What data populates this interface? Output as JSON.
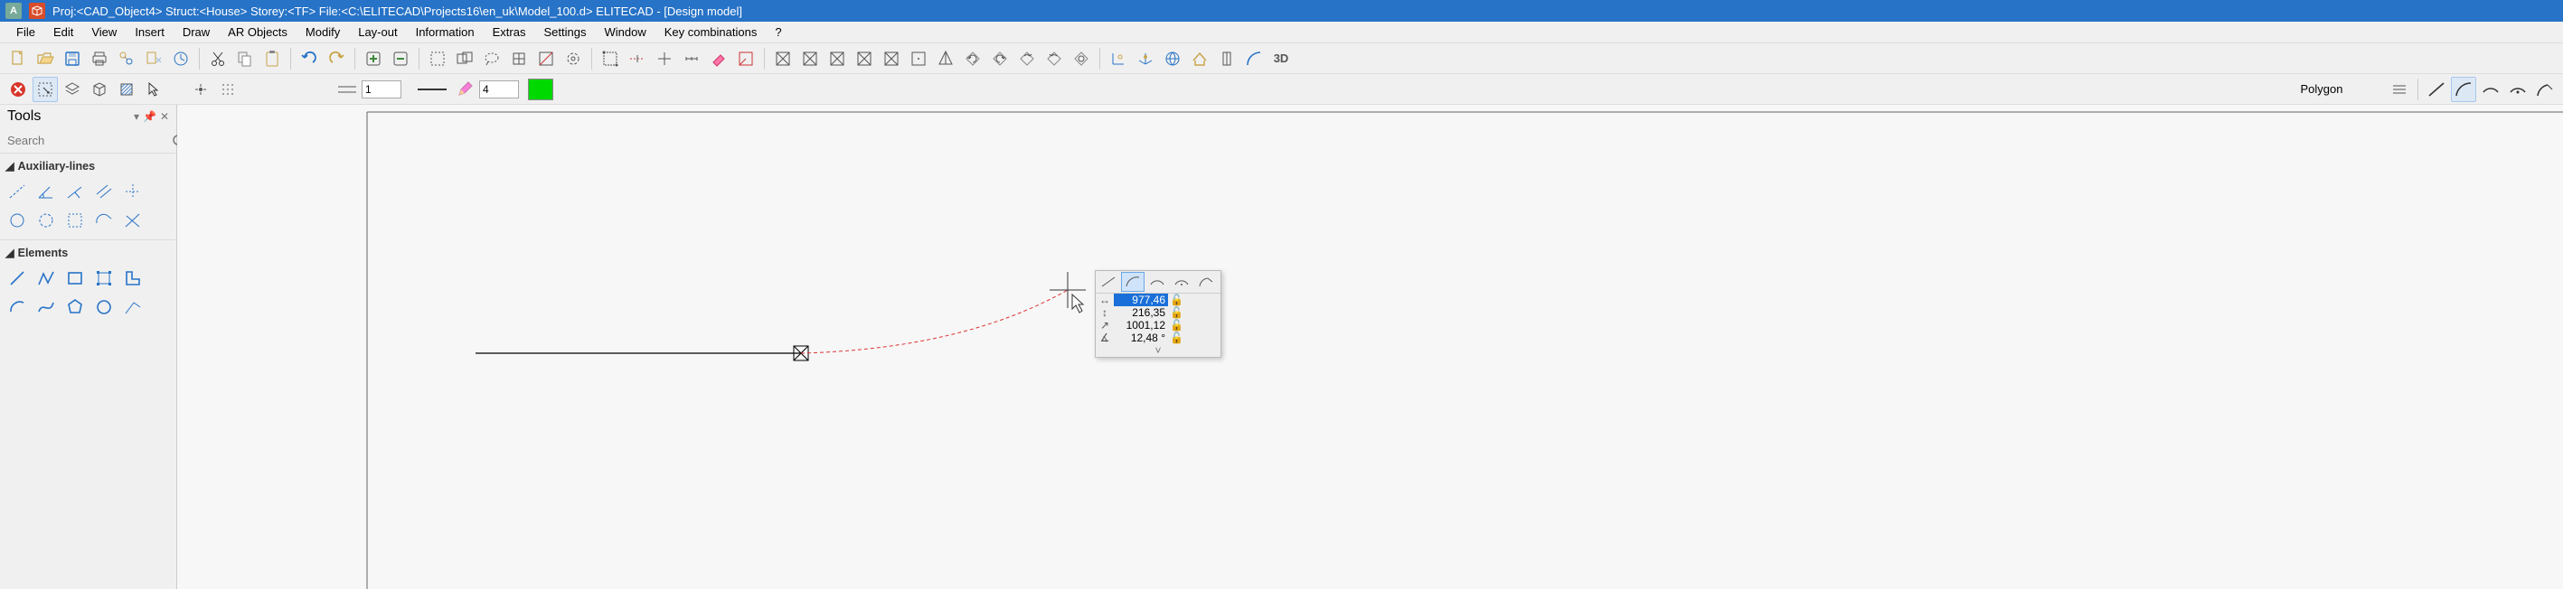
{
  "titlebar": {
    "text": "Proj:<CAD_Object4>  Struct:<House>  Storey:<TF>  File:<C:\\ELITECAD\\Projects16\\en_uk\\Model_100.d>  ELITECAD - [Design model]"
  },
  "menu": {
    "items": [
      "File",
      "Edit",
      "View",
      "Insert",
      "Draw",
      "AR Objects",
      "Modify",
      "Lay-out",
      "Information",
      "Extras",
      "Settings",
      "Window",
      "Key combinations",
      "?"
    ]
  },
  "toolbar1": {
    "layer_input": "1",
    "pen_input": "4"
  },
  "mode_label": "Polygon",
  "tools_panel": {
    "title": "Tools",
    "search_placeholder": "Search",
    "sections": {
      "aux": "Auxiliary-lines",
      "elements": "Elements"
    }
  },
  "float": {
    "dx": "977,46",
    "dy": "216,35",
    "len": "1001,12",
    "ang": "12,48 °"
  },
  "icons": {
    "new": "new-file",
    "open": "open-folder",
    "save": "save",
    "print": "print",
    "copyprops": "copy-properties",
    "paste": "paste-clipboard",
    "history": "history",
    "cut": "cut",
    "copy": "copy",
    "clipboard": "clipboard",
    "undo": "undo",
    "redo": "redo",
    "plus": "zoom-in",
    "minus": "zoom-out",
    "sel1": "select-window",
    "sel2": "select-crossing",
    "sel3": "select-lasso",
    "sel4": "select-fence",
    "sel5": "select-edit",
    "sel6": "select-cycle",
    "snap1": "snap-endpoint",
    "snap2": "snap-mid",
    "snap3": "snap-perp",
    "snap4": "snap-center",
    "erase": "eraser",
    "editpoly": "edit-polyline",
    "x1": "viewbox-1",
    "x2": "viewbox-2",
    "x3": "viewbox-3",
    "x4": "viewbox-4",
    "x5": "viewbox-5",
    "x6": "viewbox-6",
    "prism": "3d-prism",
    "rotleft": "rotate-left",
    "rotright": "rotate-right",
    "rotcw": "rotate-cw",
    "rotccw": "rotate-ccw",
    "refresh": "refresh",
    "coord": "coordinate-toggle",
    "world": "world-axes",
    "globe": "georef",
    "roof": "roof",
    "pillar": "column",
    "arc": "large-arc",
    "threeD": "3d-mode",
    "close": "close-x",
    "marquee": "marquee-select",
    "layers": "layers",
    "block": "block",
    "hatch": "hatch",
    "arrow": "pointer",
    "pt": "point",
    "grid": "grid-toggle",
    "linetype": "line-type",
    "lineweight": "line-weight",
    "pen": "pencil",
    "swatch": "color-swatch",
    "three_lines": "menu-lines",
    "draw_line": "draw-line",
    "draw_arc": "draw-arc-tangent",
    "draw_arc2": "draw-arc-3pt",
    "draw_arc3": "draw-arc-center",
    "draw_arc4": "draw-arc-end"
  }
}
